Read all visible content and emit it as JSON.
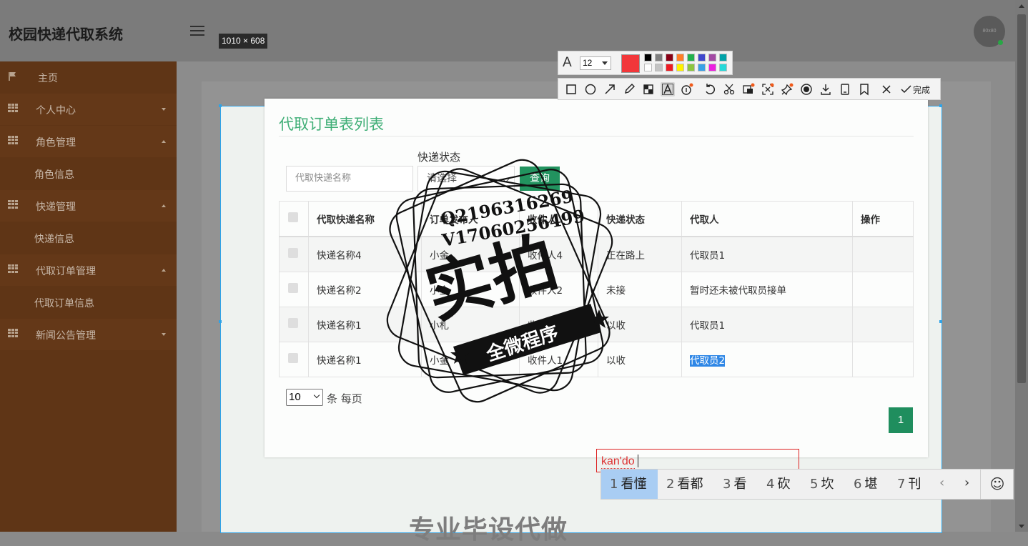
{
  "header": {
    "app_title": "校园快递代取系统",
    "avatar_text": "80x80"
  },
  "sidebar": {
    "items": [
      {
        "label": "主页",
        "icon": "flag-icon",
        "type": "item"
      },
      {
        "label": "个人中心",
        "icon": "grid-icon",
        "type": "parent",
        "expanded": false
      },
      {
        "label": "角色管理",
        "icon": "grid-icon",
        "type": "parent",
        "expanded": true
      },
      {
        "label": "角色信息",
        "type": "sub"
      },
      {
        "label": "快递管理",
        "icon": "grid-icon",
        "type": "parent",
        "expanded": true
      },
      {
        "label": "快递信息",
        "type": "sub"
      },
      {
        "label": "代取订单管理",
        "icon": "grid-icon",
        "type": "parent",
        "expanded": true
      },
      {
        "label": "代取订单信息",
        "type": "sub"
      },
      {
        "label": "新闻公告管理",
        "icon": "grid-icon",
        "type": "parent",
        "expanded": false
      }
    ]
  },
  "capture": {
    "size_label": "1010 × 608"
  },
  "card": {
    "title": "代取订单表列表",
    "search": {
      "placeholder": "代取快递名称",
      "status_label": "快递状态",
      "status_value": "请选择",
      "query_label": "查询"
    },
    "table": {
      "headers": [
        "代取快递名称",
        "订单发布人",
        "收件人",
        "快递状态",
        "代取人",
        "操作"
      ],
      "rows": [
        [
          "快递名称4",
          "小金",
          "收件人4",
          "正在路上",
          "代取员1",
          ""
        ],
        [
          "快递名称2",
          "小金",
          "收件人2",
          "未接",
          "暂时还未被代取员接单",
          ""
        ],
        [
          "快递名称1",
          "小札",
          "收件人1",
          "以收",
          "代取员1",
          ""
        ],
        [
          "快递名称1",
          "小金",
          "收件人1",
          "以收",
          "代取员2",
          ""
        ]
      ]
    },
    "pagination": {
      "page_size": "10",
      "page_size_label": "条 每页",
      "current_page": "1"
    }
  },
  "watermark": {
    "line1": "Q2196316269",
    "line2": "V17060256499",
    "main": "实拍",
    "banner": "全微程序"
  },
  "bottom_partial_text": "专业毕设代做",
  "screenshot_toolbar": {
    "font_size": "12",
    "current_color": "#f2373a",
    "palette": [
      "#000000",
      "#7f7f7f",
      "#880015",
      "#ff7f27",
      "#22b14c",
      "#3f48cc",
      "#a349a4",
      "#00a2a8",
      "#ffffff",
      "#c3c3c3",
      "#ed1c24",
      "#fff200",
      "#8cc540",
      "#3aa0e6",
      "#ec1ee0",
      "#26d9d9"
    ],
    "tools": [
      "rectangle-icon",
      "ellipse-icon",
      "arrow-icon",
      "pencil-icon",
      "mosaic-icon",
      "text-icon",
      "number-icon",
      "undo-icon",
      "crop-icon",
      "ocr-icon",
      "expand-icon",
      "pin-icon",
      "record-icon",
      "download-icon",
      "save-icon",
      "bookmark-icon",
      "close-icon",
      "check-icon"
    ],
    "done_label": "完成"
  },
  "text_annotation": {
    "value": "kan'do"
  },
  "ime": {
    "candidates": [
      {
        "num": "1",
        "text": "看懂"
      },
      {
        "num": "2",
        "text": "看都"
      },
      {
        "num": "3",
        "text": "看"
      },
      {
        "num": "4",
        "text": "砍"
      },
      {
        "num": "5",
        "text": "坎"
      },
      {
        "num": "6",
        "text": "堪"
      },
      {
        "num": "7",
        "text": "刊"
      }
    ],
    "prev": "‹",
    "next": "›",
    "emoji": "☺"
  }
}
